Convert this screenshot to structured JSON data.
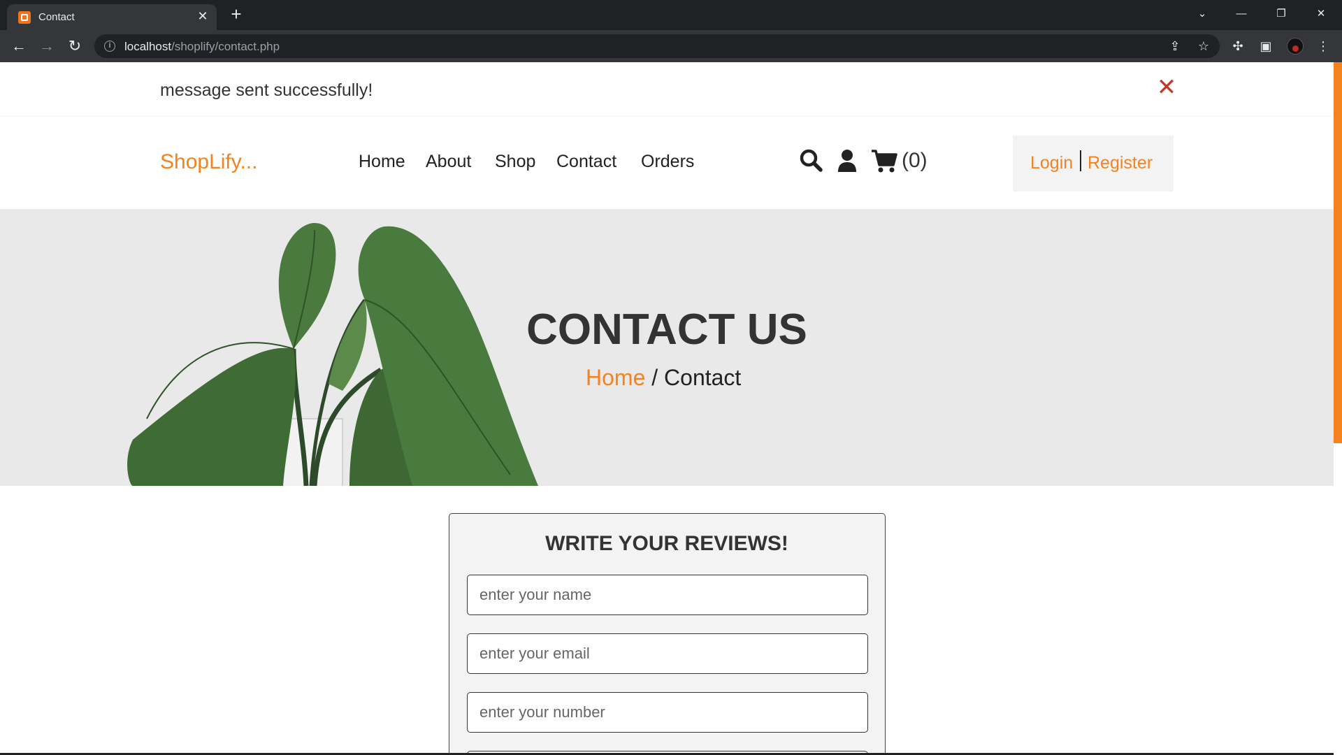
{
  "browser": {
    "tab_title": "Contact",
    "url_host": "localhost",
    "url_path": "/shoplify/contact.php"
  },
  "message": {
    "text": "message sent successfully!"
  },
  "header": {
    "logo": "ShopLify...",
    "nav": [
      "Home",
      "About",
      "Shop",
      "Contact",
      "Orders"
    ],
    "cart_count": "(0)",
    "login": "Login",
    "register": "Register"
  },
  "banner": {
    "title": "CONTACT US",
    "breadcrumb_home": "Home",
    "breadcrumb_sep": " / ",
    "breadcrumb_current": "Contact"
  },
  "form": {
    "title": "WRITE YOUR REVIEWS!",
    "name_placeholder": "enter your name",
    "email_placeholder": "enter your email",
    "number_placeholder": "enter your number"
  },
  "colors": {
    "accent": "#f5821f",
    "close": "#c0392b",
    "banner_bg": "#e9e9e9"
  },
  "icons": [
    "search-icon",
    "user-icon",
    "cart-icon",
    "close-icon"
  ]
}
